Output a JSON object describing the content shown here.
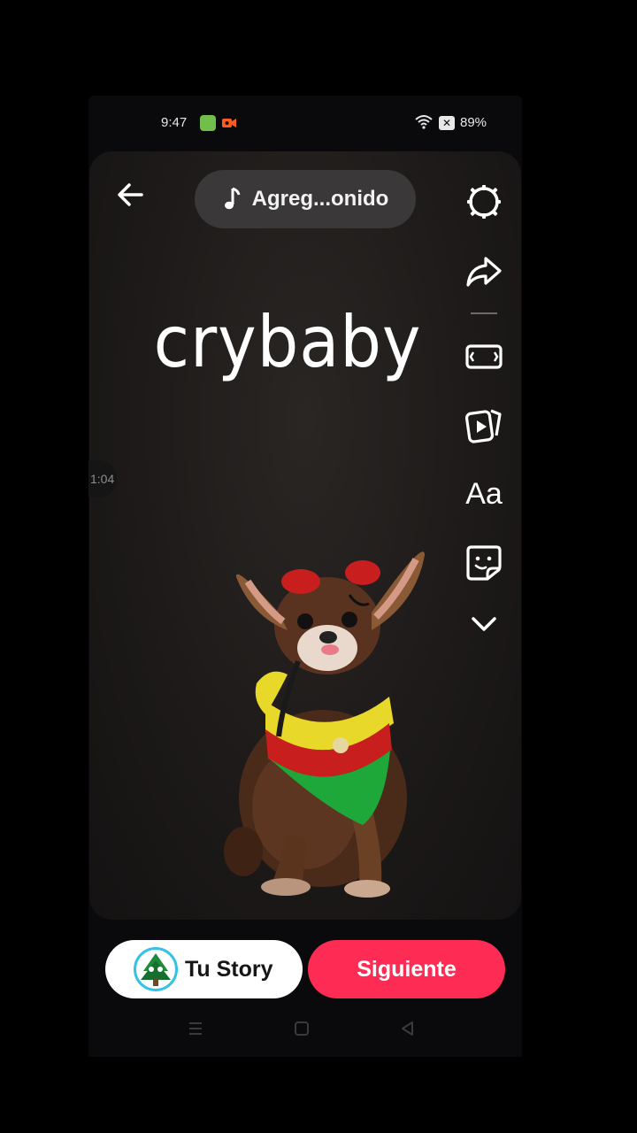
{
  "status_bar": {
    "time": "9:47",
    "battery_x": "✕",
    "battery_percent": "89%"
  },
  "editor": {
    "sound_button_label": "Agreg...onido",
    "headline_text": "crybaby",
    "time_marker": "1:04",
    "text_tool_label": "Aa",
    "tools": [
      "settings-icon",
      "share-icon",
      "aspect-ratio-icon",
      "video-cards-icon",
      "text-icon",
      "sticker-icon",
      "chevron-down-icon"
    ]
  },
  "actions": {
    "story_label": "Tu Story",
    "next_label": "Siguiente"
  },
  "colors": {
    "next_button": "#fe2c55",
    "avatar_ring": "#35c2e6",
    "background": "#000000"
  }
}
